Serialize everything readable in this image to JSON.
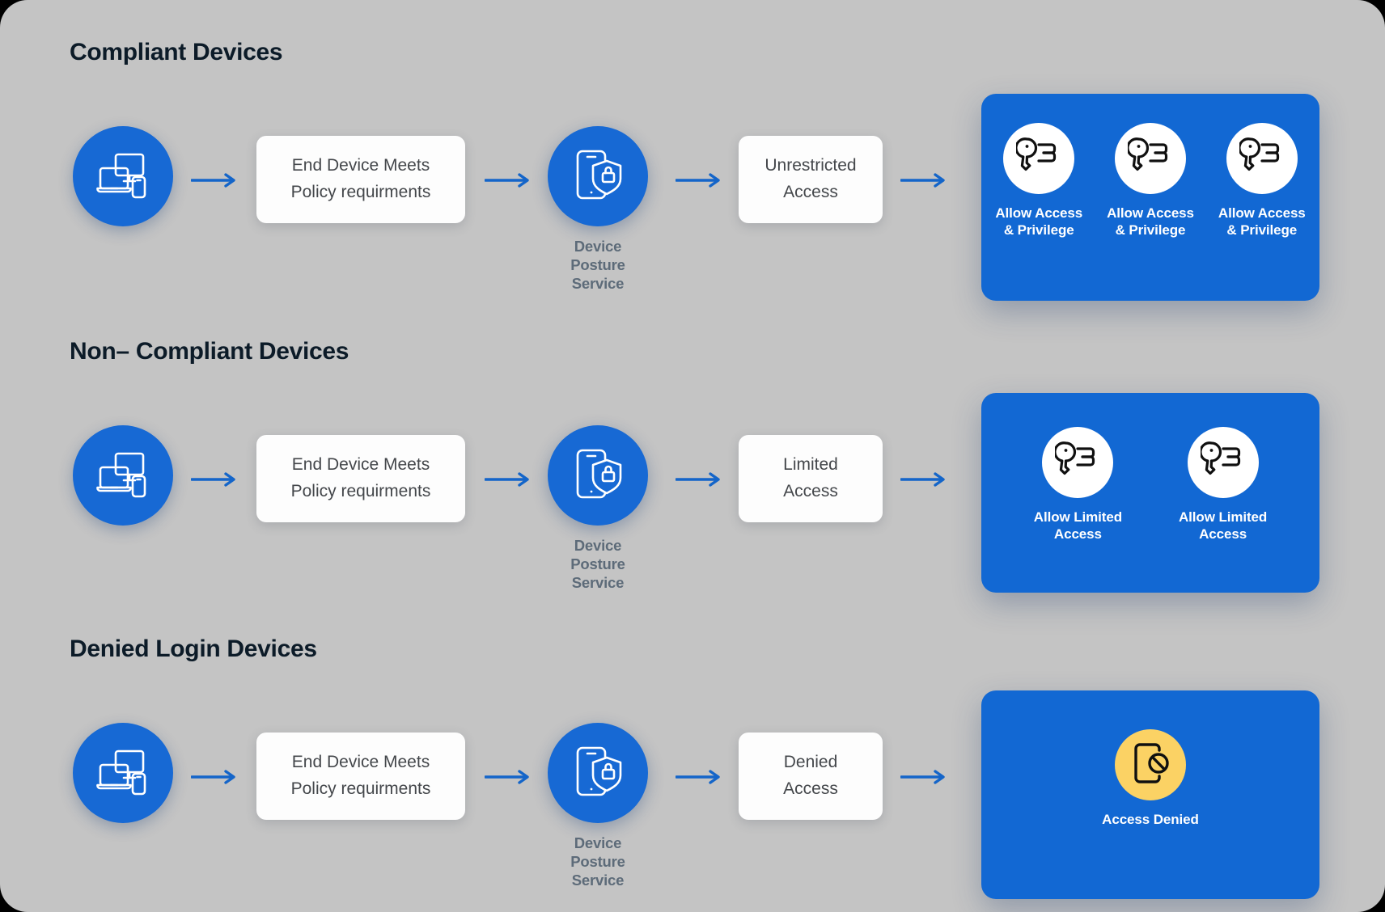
{
  "canvas": {
    "background_color": "#c4c4c4",
    "accent_blue": "#1268d3",
    "device_circle_color": "#1769d4",
    "amber": "#fbd264",
    "heading_color": "#0c1b28",
    "card_text_color": "#44474b",
    "posture_label_color": "#5d6b79"
  },
  "sections": [
    {
      "id": "compliant",
      "title": "Compliant Devices",
      "device_icon": "devices-monitor-laptop-phone-icon",
      "policy_card": {
        "line1": "End Device Meets",
        "line2": "Policy requirments"
      },
      "posture": {
        "icon": "phone-shield-lock-icon",
        "line1": "Device Posture",
        "line2": "Service"
      },
      "access_card": {
        "line1": "Unrestricted",
        "line2": "Access"
      },
      "result": {
        "panel_color": "#1268d3",
        "items": [
          {
            "icon": "key-access-icon",
            "icon_bg": "#ffffff",
            "line1": "Allow Access",
            "line2": "& Privilege"
          },
          {
            "icon": "key-access-icon",
            "icon_bg": "#ffffff",
            "line1": "Allow Access",
            "line2": "& Privilege"
          },
          {
            "icon": "key-access-icon",
            "icon_bg": "#ffffff",
            "line1": "Allow Access",
            "line2": "& Privilege"
          }
        ]
      }
    },
    {
      "id": "non-compliant",
      "title": "Non– Compliant Devices",
      "device_icon": "devices-monitor-laptop-phone-icon",
      "policy_card": {
        "line1": "End Device Meets",
        "line2": "Policy requirments"
      },
      "posture": {
        "icon": "phone-shield-lock-icon",
        "line1": "Device Posture",
        "line2": "Service"
      },
      "access_card": {
        "line1": "Limited",
        "line2": "Access"
      },
      "result": {
        "panel_color": "#1268d3",
        "items": [
          {
            "icon": "key-access-icon",
            "icon_bg": "#ffffff",
            "line1": "Allow Limited",
            "line2": "Access"
          },
          {
            "icon": "key-access-icon",
            "icon_bg": "#ffffff",
            "line1": "Allow Limited",
            "line2": "Access"
          }
        ]
      }
    },
    {
      "id": "denied",
      "title": "Denied Login Devices",
      "device_icon": "devices-monitor-laptop-phone-icon",
      "policy_card": {
        "line1": "End Device Meets",
        "line2": "Policy requirments"
      },
      "posture": {
        "icon": "phone-shield-lock-icon",
        "line1": "Device Posture",
        "line2": "Service"
      },
      "access_card": {
        "line1": "Denied",
        "line2": "Access"
      },
      "result": {
        "panel_color": "#1268d3",
        "items": [
          {
            "icon": "access-denied-icon",
            "icon_bg": "#fbd264",
            "line1": "Access Denied",
            "line2": ""
          }
        ]
      }
    }
  ]
}
